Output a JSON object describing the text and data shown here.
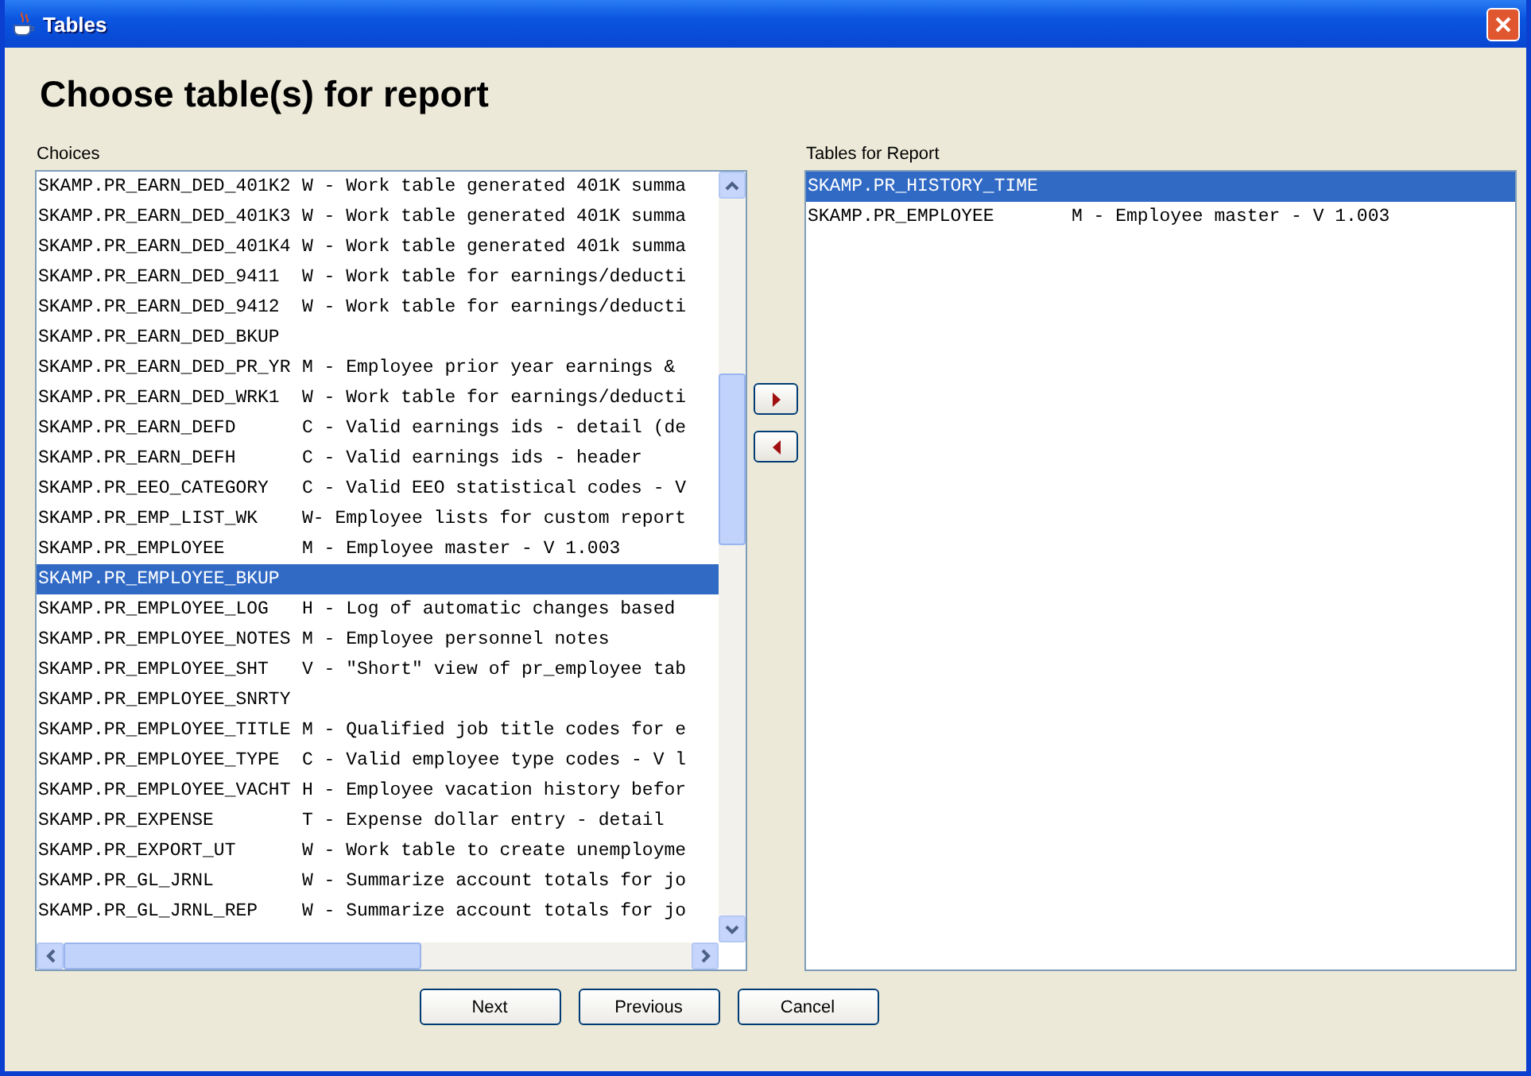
{
  "window": {
    "title": "Tables"
  },
  "heading": "Choose table(s) for report",
  "choices": {
    "label": "Choices",
    "rows": [
      {
        "name": "SKAMP.PR_EARN_DED_401K2",
        "description": "W - Work table generated 401K summa",
        "selected": false
      },
      {
        "name": "SKAMP.PR_EARN_DED_401K3",
        "description": "W - Work table generated 401K summa",
        "selected": false
      },
      {
        "name": "SKAMP.PR_EARN_DED_401K4",
        "description": "W - Work table generated 401k summa",
        "selected": false
      },
      {
        "name": "SKAMP.PR_EARN_DED_9411",
        "description": "W - Work table for earnings/deducti",
        "selected": false
      },
      {
        "name": "SKAMP.PR_EARN_DED_9412",
        "description": "W - Work table for earnings/deducti",
        "selected": false
      },
      {
        "name": "SKAMP.PR_EARN_DED_BKUP",
        "selected": false
      },
      {
        "name": "SKAMP.PR_EARN_DED_PR_YR",
        "description": "M - Employee prior year earnings &",
        "selected": false
      },
      {
        "name": "SKAMP.PR_EARN_DED_WRK1",
        "description": "W - Work table for earnings/deducti",
        "selected": false
      },
      {
        "name": "SKAMP.PR_EARN_DEFD",
        "description": "C - Valid earnings ids - detail (de",
        "selected": false
      },
      {
        "name": "SKAMP.PR_EARN_DEFH",
        "description": "C - Valid earnings ids - header",
        "selected": false
      },
      {
        "name": "SKAMP.PR_EEO_CATEGORY",
        "description": "C - Valid EEO statistical codes - V",
        "selected": false
      },
      {
        "name": "SKAMP.PR_EMP_LIST_WK",
        "description": "W- Employee lists for custom report",
        "selected": false
      },
      {
        "name": "SKAMP.PR_EMPLOYEE",
        "description": "M - Employee master - V 1.003",
        "selected": false
      },
      {
        "name": "SKAMP.PR_EMPLOYEE_BKUP",
        "selected": true
      },
      {
        "name": "SKAMP.PR_EMPLOYEE_LOG",
        "description": "H - Log of automatic changes based",
        "selected": false
      },
      {
        "name": "SKAMP.PR_EMPLOYEE_NOTES",
        "description": "M - Employee personnel notes",
        "selected": false
      },
      {
        "name": "SKAMP.PR_EMPLOYEE_SHT",
        "description": "V - \"Short\" view of pr_employee tab",
        "selected": false
      },
      {
        "name": "SKAMP.PR_EMPLOYEE_SNRTY",
        "selected": false
      },
      {
        "name": "SKAMP.PR_EMPLOYEE_TITLE",
        "description": "M - Qualified job title codes for e",
        "selected": false
      },
      {
        "name": "SKAMP.PR_EMPLOYEE_TYPE",
        "description": "C - Valid employee type codes - V l",
        "selected": false
      },
      {
        "name": "SKAMP.PR_EMPLOYEE_VACHT",
        "description": "H - Employee vacation history befor",
        "selected": false
      },
      {
        "name": "SKAMP.PR_EXPENSE",
        "description": "T - Expense dollar entry - detail",
        "selected": false
      },
      {
        "name": "SKAMP.PR_EXPORT_UT",
        "description": "W - Work table to create unemployme",
        "selected": false
      },
      {
        "name": "SKAMP.PR_GL_JRNL",
        "description": "W - Summarize account totals for jo",
        "selected": false
      },
      {
        "name": "SKAMP.PR_GL_JRNL_REP",
        "description": "W - Summarize account totals for jo",
        "selected": false
      }
    ]
  },
  "report_tables": {
    "label": "Tables for Report",
    "rows": [
      {
        "name": "SKAMP.PR_HISTORY_TIME",
        "selected": true
      },
      {
        "name": "SKAMP.PR_EMPLOYEE",
        "description": "M - Employee master - V 1.003",
        "selected": false
      }
    ]
  },
  "buttons": [
    "Next",
    "Previous",
    "Cancel"
  ]
}
